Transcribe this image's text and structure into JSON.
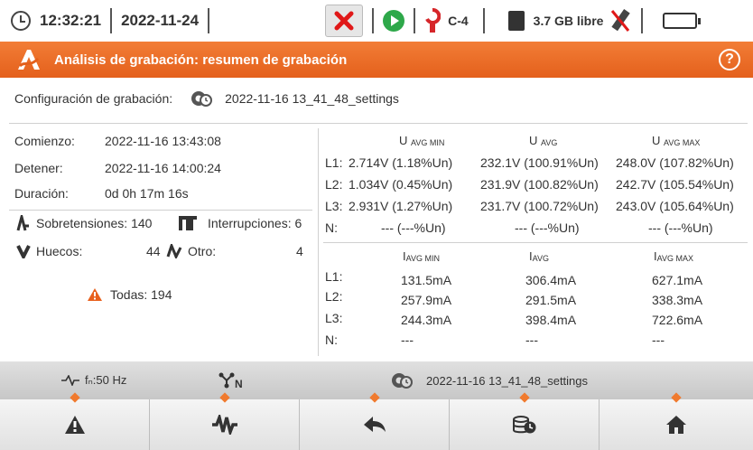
{
  "status": {
    "time": "12:32:21",
    "date": "2022-11-24",
    "clamp": "C-4",
    "storage": "3.7 GB libre"
  },
  "title": "Análisis de grabación: resumen de grabación",
  "help": "?",
  "config": {
    "label": "Configuración de grabación:",
    "value": "2022-11-16 13_41_48_settings"
  },
  "summary": {
    "start_label": "Comienzo:",
    "start": "2022-11-16 13:43:08",
    "stop_label": "Detener:",
    "stop": "2022-11-16 14:00:24",
    "dur_label": "Duración:",
    "duration": "0d 0h 17m 16s"
  },
  "events": {
    "swell_label": "Sobretensiones:",
    "swell": "140",
    "interrupt_label": "Interrupciones:",
    "interrupt": "6",
    "dip_label": "Huecos:",
    "dip": "44",
    "other_label": "Otro:",
    "other": "4",
    "all": "Todas: 194"
  },
  "voltage": {
    "h_min": "U",
    "h_min_sub": "AVG MIN",
    "h_avg": "U",
    "h_avg_sub": "AVG",
    "h_max": "U",
    "h_max_sub": "AVG MAX",
    "rows": [
      {
        "ph": "L1:",
        "min": "2.714V (1.18%Un)",
        "avg": "232.1V (100.91%Un)",
        "max": "248.0V (107.82%Un)"
      },
      {
        "ph": "L2:",
        "min": "1.034V (0.45%Un)",
        "avg": "231.9V (100.82%Un)",
        "max": "242.7V (105.54%Un)"
      },
      {
        "ph": "L3:",
        "min": "2.931V (1.27%Un)",
        "avg": "231.7V (100.72%Un)",
        "max": "243.0V (105.64%Un)"
      },
      {
        "ph": "N:",
        "min": "--- (---%Un)",
        "avg": "--- (---%Un)",
        "max": "--- (---%Un)"
      }
    ]
  },
  "current": {
    "h_min": "I",
    "h_min_sub": "AVG MIN",
    "h_avg": "I",
    "h_avg_sub": "AVG",
    "h_max": "I",
    "h_max_sub": "AVG MAX",
    "rows": [
      {
        "ph": "L1:",
        "min": "131.5mA",
        "avg": "306.4mA",
        "max": "627.1mA"
      },
      {
        "ph": "L2:",
        "min": "257.9mA",
        "avg": "291.5mA",
        "max": "338.3mA"
      },
      {
        "ph": "L3:",
        "min": "244.3mA",
        "avg": "398.4mA",
        "max": "722.6mA"
      },
      {
        "ph": "N:",
        "min": "---",
        "avg": "---",
        "max": "---"
      }
    ]
  },
  "infobar": {
    "freq": "fₙ:50 Hz",
    "net": "N",
    "settings": "2022-11-16 13_41_48_settings"
  },
  "nav_icons": [
    "warning-icon",
    "waveform-icon",
    "back-arrow-icon",
    "database-clock-icon",
    "home-icon"
  ],
  "colors": {
    "accent": "#e86a26",
    "warning": "#e8601c"
  }
}
